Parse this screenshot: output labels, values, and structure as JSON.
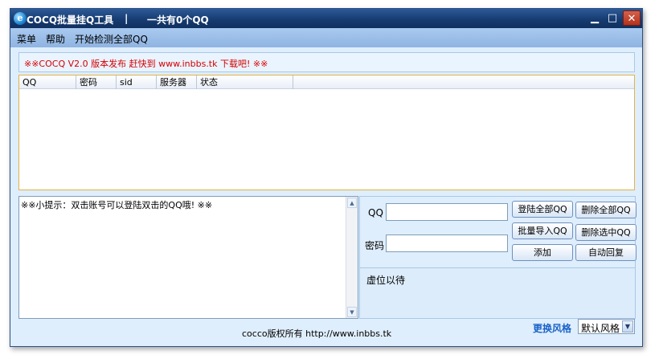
{
  "titlebar": {
    "logo_glyph": "e",
    "title": "COCQ批量挂Q工具",
    "separator": "|",
    "count_text": "一共有0个QQ",
    "min_glyph": "▁",
    "max_glyph": "□",
    "close_glyph": "✕"
  },
  "menu": {
    "items": [
      {
        "label": "菜单"
      },
      {
        "label": "帮助"
      },
      {
        "label": "开始检测全部QQ"
      }
    ]
  },
  "notice": {
    "text": "※※COCQ V2.0 版本发布 赶快到 www.inbbs.tk 下载吧! ※※",
    "color": "#d40000"
  },
  "table": {
    "columns": [
      "QQ",
      "密码",
      "sid",
      "服务器",
      "状态"
    ],
    "rows": []
  },
  "log": {
    "text": "※※小提示：双击账号可以登陆双击的QQ哦! ※※"
  },
  "form": {
    "qq_label": "QQ",
    "password_label": "密码",
    "qq_value": "",
    "password_value": ""
  },
  "buttons": {
    "login_all": "登陆全部QQ",
    "delete_all": "删除全部QQ",
    "batch_import": "批量导入QQ",
    "delete_selected": "删除选中QQ",
    "add": "添加",
    "auto_reply": "自动回复"
  },
  "status": {
    "text": "虚位以待"
  },
  "footer": {
    "copyright": "cocco版权所有 http://www.inbbs.tk",
    "theme_label": "更换风格",
    "theme_value": "默认风格",
    "accent_color": "#1a62c8"
  },
  "icons": {
    "scroll_up": "▲",
    "scroll_down": "▼",
    "dropdown": "▼"
  }
}
